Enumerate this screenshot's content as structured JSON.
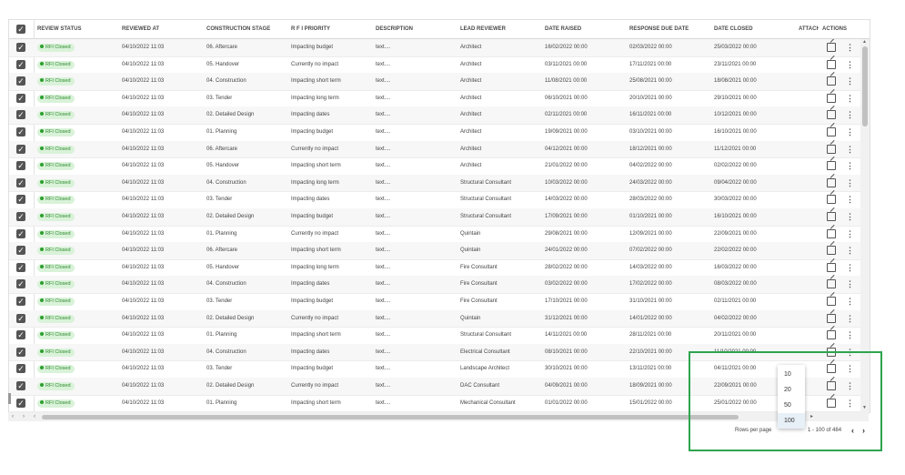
{
  "columns": {
    "review_status": "REVIEW STATUS",
    "reviewed_at": "REVIEWED AT",
    "construction_stage": "CONSTRUCTION STAGE",
    "rfi_priority": "R F I PRIORITY",
    "description": "DESCRIPTION",
    "lead_reviewer": "LEAD REVIEWER",
    "date_raised": "DATE RAISED",
    "response_due_date": "RESPONSE DUE DATE",
    "date_closed": "DATE CLOSED",
    "attach": "ATTACH",
    "actions": "ACTIONS"
  },
  "checkbox_glyph": "✓",
  "rows": [
    {
      "status": "RFI Closed",
      "reviewed_at": "04/10/2022 11:03",
      "stage": "06. Aftercare",
      "priority": "Impacting budget",
      "description": "text....",
      "reviewer": "Architect",
      "raised": "16/02/2022 00:00",
      "due": "02/03/2022 00:00",
      "closed": "25/03/2022 00:00"
    },
    {
      "status": "RFI Closed",
      "reviewed_at": "04/10/2022 11:03",
      "stage": "05. Handover",
      "priority": "Currently no impact",
      "description": "text....",
      "reviewer": "Architect",
      "raised": "03/11/2021 00:00",
      "due": "17/11/2021 00:00",
      "closed": "23/11/2021 00:00"
    },
    {
      "status": "RFI Closed",
      "reviewed_at": "04/10/2022 11:03",
      "stage": "04. Construction",
      "priority": "Impacting short term",
      "description": "text....",
      "reviewer": "Architect",
      "raised": "11/08/2021 00:00",
      "due": "25/08/2021 00:00",
      "closed": "18/08/2021 00:00"
    },
    {
      "status": "RFI Closed",
      "reviewed_at": "04/10/2022 11:03",
      "stage": "03. Tender",
      "priority": "Impacting long term",
      "description": "text....",
      "reviewer": "Architect",
      "raised": "06/10/2021 00:00",
      "due": "20/10/2021 00:00",
      "closed": "29/10/2021 00:00"
    },
    {
      "status": "RFI Closed",
      "reviewed_at": "04/10/2022 11:03",
      "stage": "02. Detailed Design",
      "priority": "Impacting dates",
      "description": "text....",
      "reviewer": "Architect",
      "raised": "02/11/2021 00:00",
      "due": "16/11/2021 00:00",
      "closed": "10/12/2021 00:00"
    },
    {
      "status": "RFI Closed",
      "reviewed_at": "04/10/2022 11:03",
      "stage": "01. Planning",
      "priority": "Impacting budget",
      "description": "text....",
      "reviewer": "Architect",
      "raised": "19/09/2021 00:00",
      "due": "03/10/2021 00:00",
      "closed": "16/10/2021 00:00"
    },
    {
      "status": "RFI Closed",
      "reviewed_at": "04/10/2022 11:03",
      "stage": "06. Aftercare",
      "priority": "Currently no impact",
      "description": "text....",
      "reviewer": "Architect",
      "raised": "04/12/2021 00:00",
      "due": "18/12/2021 00:00",
      "closed": "11/12/2021 00:00"
    },
    {
      "status": "RFI Closed",
      "reviewed_at": "04/10/2022 11:03",
      "stage": "05. Handover",
      "priority": "Impacting short term",
      "description": "text....",
      "reviewer": "Architect",
      "raised": "21/01/2022 00:00",
      "due": "04/02/2022 00:00",
      "closed": "02/02/2022 00:00"
    },
    {
      "status": "RFI Closed",
      "reviewed_at": "04/10/2022 11:03",
      "stage": "04. Construction",
      "priority": "Impacting long term",
      "description": "text....",
      "reviewer": "Structural Consultant",
      "raised": "10/03/2022 00:00",
      "due": "24/03/2022 00:00",
      "closed": "09/04/2022 00:00"
    },
    {
      "status": "RFI Closed",
      "reviewed_at": "04/10/2022 11:03",
      "stage": "03. Tender",
      "priority": "Impacting dates",
      "description": "text....",
      "reviewer": "Structural Consultant",
      "raised": "14/03/2022 00:00",
      "due": "28/03/2022 00:00",
      "closed": "30/03/2022 00:00"
    },
    {
      "status": "RFI Closed",
      "reviewed_at": "04/10/2022 11:03",
      "stage": "02. Detailed Design",
      "priority": "Impacting budget",
      "description": "text....",
      "reviewer": "Structural Consultant",
      "raised": "17/09/2021 00:00",
      "due": "01/10/2021 00:00",
      "closed": "16/10/2021 00:00"
    },
    {
      "status": "RFI Closed",
      "reviewed_at": "04/10/2022 11:03",
      "stage": "01. Planning",
      "priority": "Currently no impact",
      "description": "text....",
      "reviewer": "Quintain",
      "raised": "29/08/2021 00:00",
      "due": "12/09/2021 00:00",
      "closed": "22/09/2021 00:00"
    },
    {
      "status": "RFI Closed",
      "reviewed_at": "04/10/2022 11:03",
      "stage": "06. Aftercare",
      "priority": "Impacting short term",
      "description": "text....",
      "reviewer": "Quintain",
      "raised": "24/01/2022 00:00",
      "due": "07/02/2022 00:00",
      "closed": "22/02/2022 00:00"
    },
    {
      "status": "RFI Closed",
      "reviewed_at": "04/10/2022 11:03",
      "stage": "05. Handover",
      "priority": "Impacting long term",
      "description": "text....",
      "reviewer": "Fire Consultant",
      "raised": "28/02/2022 00:00",
      "due": "14/03/2022 00:00",
      "closed": "16/03/2022 00:00"
    },
    {
      "status": "RFI Closed",
      "reviewed_at": "04/10/2022 11:03",
      "stage": "04. Construction",
      "priority": "Impacting dates",
      "description": "text....",
      "reviewer": "Fire Consultant",
      "raised": "03/02/2022 00:00",
      "due": "17/02/2022 00:00",
      "closed": "08/03/2022 00:00"
    },
    {
      "status": "RFI Closed",
      "reviewed_at": "04/10/2022 11:03",
      "stage": "03. Tender",
      "priority": "Impacting budget",
      "description": "text....",
      "reviewer": "Fire Consultant",
      "raised": "17/10/2021 00:00",
      "due": "31/10/2021 00:00",
      "closed": "02/11/2021 00:00"
    },
    {
      "status": "RFI Closed",
      "reviewed_at": "04/10/2022 11:03",
      "stage": "02. Detailed Design",
      "priority": "Currently no impact",
      "description": "text....",
      "reviewer": "Quintain",
      "raised": "31/12/2021 00:00",
      "due": "14/01/2022 00:00",
      "closed": "04/02/2022 00:00"
    },
    {
      "status": "RFI Closed",
      "reviewed_at": "04/10/2022 11:03",
      "stage": "01. Planning",
      "priority": "Impacting short term",
      "description": "text....",
      "reviewer": "Structural Consultant",
      "raised": "14/11/2021 00:00",
      "due": "28/11/2021 00:00",
      "closed": "20/11/2021 00:00"
    },
    {
      "status": "RFI Closed",
      "reviewed_at": "04/10/2022 11:03",
      "stage": "04. Construction",
      "priority": "Impacting dates",
      "description": "text....",
      "reviewer": "Electrical Consultant",
      "raised": "08/10/2021 00:00",
      "due": "22/10/2021 00:00",
      "closed": "11/10/2021 00:00"
    },
    {
      "status": "RFI Closed",
      "reviewed_at": "04/10/2022 11:03",
      "stage": "03. Tender",
      "priority": "Impacting budget",
      "description": "text....",
      "reviewer": "Landscape Architect",
      "raised": "30/10/2021 00:00",
      "due": "13/11/2021 00:00",
      "closed": "04/11/2021 00:00"
    },
    {
      "status": "RFI Closed",
      "reviewed_at": "04/10/2022 11:03",
      "stage": "02. Detailed Design",
      "priority": "Currently no impact",
      "description": "text....",
      "reviewer": "DAC Consultant",
      "raised": "04/09/2021 00:00",
      "due": "18/09/2021 00:00",
      "closed": "22/09/2021 00:00"
    },
    {
      "status": "RFI Closed",
      "reviewed_at": "04/10/2022 11:03",
      "stage": "01. Planning",
      "priority": "Impacting short term",
      "description": "text....",
      "reviewer": "Mechanical Consultant",
      "raised": "01/01/2022 00:00",
      "due": "15/01/2022 00:00",
      "closed": "25/01/2022 00:00"
    }
  ],
  "pagination": {
    "rows_per_page_label": "Rows per page",
    "range_text": "1 - 100 of 484",
    "prev_glyph": "‹",
    "next_glyph": "›",
    "options": [
      "10",
      "20",
      "50",
      "100"
    ],
    "selected": "100"
  },
  "scroll_glyphs": {
    "left": "‹",
    "right": "›",
    "up": "▲",
    "down": "▼",
    "play": "▸"
  },
  "colors": {
    "accent_highlight": "#2ea44f",
    "status_badge_bg": "#d9f2d9",
    "status_badge_text": "#2e8b2e"
  }
}
